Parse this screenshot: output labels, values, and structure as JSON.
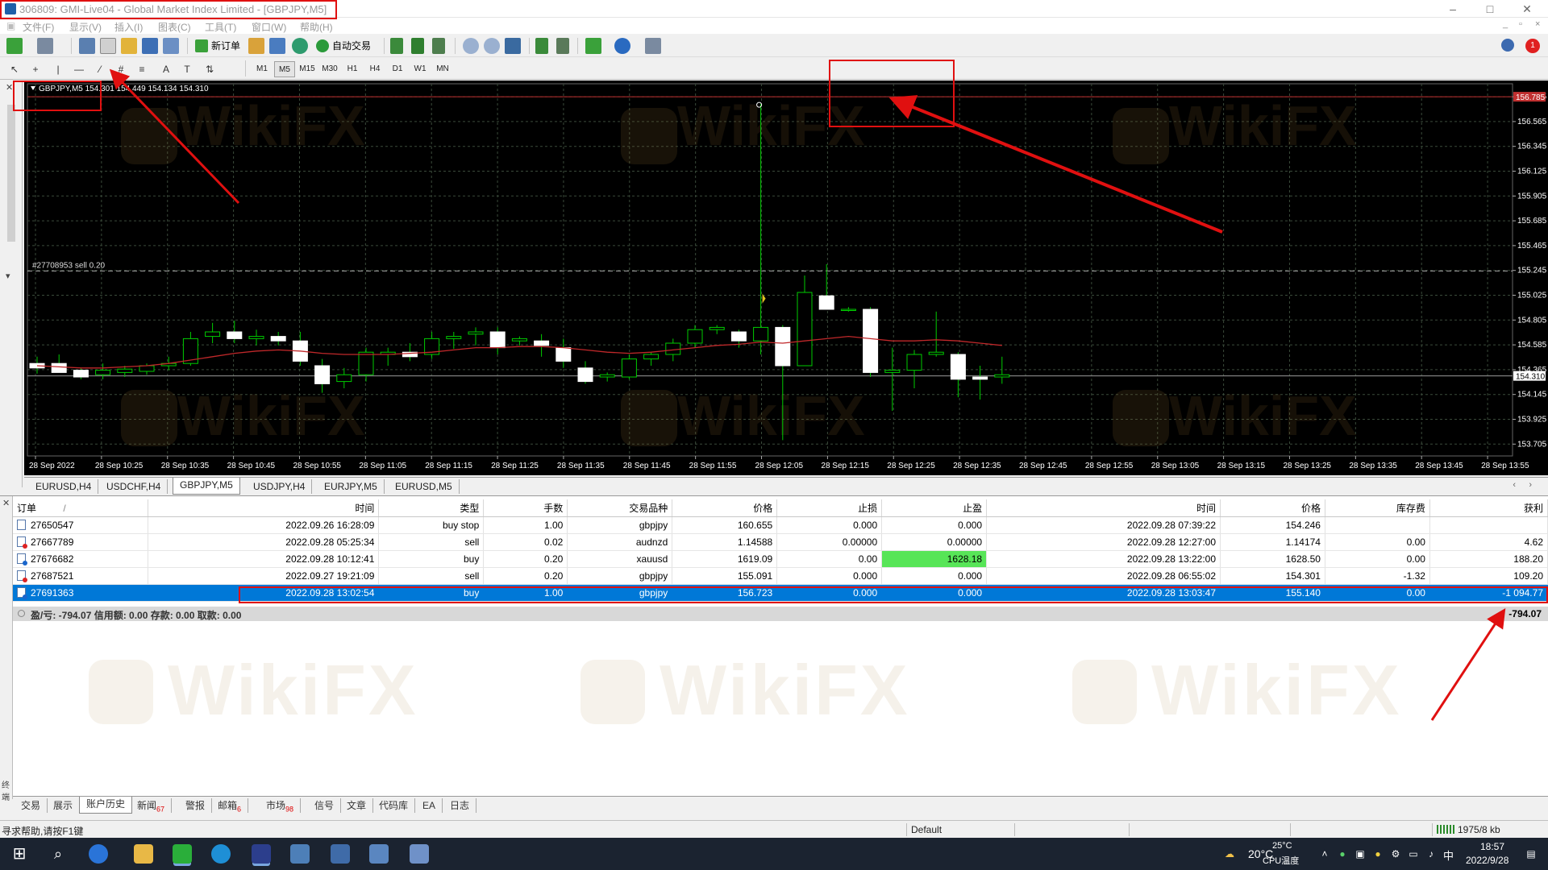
{
  "window": {
    "title": "306809: GMI-Live04 - Global Market Index Limited - [GBPJPY,M5]",
    "controls": [
      "–",
      "□",
      "✕"
    ]
  },
  "menu": {
    "items": [
      "文件(F)",
      "显示(V)",
      "插入(I)",
      "图表(C)",
      "工具(T)",
      "窗口(W)",
      "帮助(H)"
    ],
    "mdi_controls": [
      "_",
      "▫",
      "×"
    ]
  },
  "toolbar": {
    "new_order_label": "新订单",
    "auto_trade_label": "自动交易",
    "timeframes": [
      "M1",
      "M5",
      "M15",
      "M30",
      "H1",
      "H4",
      "D1",
      "W1",
      "MN"
    ],
    "active_timeframe": "M5",
    "draw_tools": [
      "↖",
      "+",
      "|",
      "—",
      "⁄",
      "#",
      "≡",
      "A",
      "T",
      "⇅"
    ],
    "alert_count": "1"
  },
  "chart": {
    "header_text": "GBPJPY,M5  154.301 154.449 154.134 154.310",
    "order_line_label": "#27708953 sell 0.20",
    "bid_label": "154.310",
    "top_label": "156.785",
    "colors": {
      "background": "#000000",
      "grid": "#3a4a3a",
      "candle_up": "#00cc00",
      "candle_body": "#ffffff",
      "ma": "#c0282a",
      "order_line": "#c03030",
      "axis_text": "#ffffff"
    }
  },
  "chart_data": {
    "type": "candlestick",
    "symbol": "GBPJPY",
    "timeframe": "M5",
    "ylim": [
      153.6,
      156.9
    ],
    "y_ticks": [
      "156.785",
      "156.565",
      "156.345",
      "156.125",
      "155.905",
      "155.685",
      "155.465",
      "155.245",
      "155.025",
      "154.805",
      "154.585",
      "154.365",
      "154.145",
      "153.925",
      "153.705"
    ],
    "x_ticks": [
      "28 Sep 2022",
      "28 Sep 10:25",
      "28 Sep 10:35",
      "28 Sep 10:45",
      "28 Sep 10:55",
      "28 Sep 11:05",
      "28 Sep 11:15",
      "28 Sep 11:25",
      "28 Sep 11:35",
      "28 Sep 11:45",
      "28 Sep 11:55",
      "28 Sep 12:05",
      "28 Sep 12:15",
      "28 Sep 12:25",
      "28 Sep 12:35",
      "28 Sep 12:45",
      "28 Sep 12:55",
      "28 Sep 13:05",
      "28 Sep 13:15",
      "28 Sep 13:25",
      "28 Sep 13:35",
      "28 Sep 13:45",
      "28 Sep 13:55"
    ],
    "candles": [
      [
        154.42,
        154.48,
        154.33,
        154.38
      ],
      [
        154.42,
        154.5,
        154.36,
        154.34
      ],
      [
        154.36,
        154.38,
        154.28,
        154.3
      ],
      [
        154.32,
        154.42,
        154.28,
        154.36
      ],
      [
        154.34,
        154.4,
        154.3,
        154.37
      ],
      [
        154.35,
        154.42,
        154.32,
        154.4
      ],
      [
        154.4,
        154.48,
        154.36,
        154.42
      ],
      [
        154.42,
        154.7,
        154.4,
        154.64
      ],
      [
        154.66,
        154.78,
        154.6,
        154.7
      ],
      [
        154.7,
        154.8,
        154.6,
        154.64
      ],
      [
        154.64,
        154.72,
        154.58,
        154.66
      ],
      [
        154.66,
        154.7,
        154.58,
        154.62
      ],
      [
        154.62,
        154.7,
        154.4,
        154.44
      ],
      [
        154.4,
        154.46,
        154.16,
        154.24
      ],
      [
        154.26,
        154.38,
        154.2,
        154.32
      ],
      [
        154.32,
        154.56,
        154.26,
        154.52
      ],
      [
        154.5,
        154.56,
        154.4,
        154.52
      ],
      [
        154.52,
        154.6,
        154.44,
        154.48
      ],
      [
        154.5,
        154.7,
        154.46,
        154.64
      ],
      [
        154.64,
        154.7,
        154.55,
        154.66
      ],
      [
        154.68,
        154.74,
        154.58,
        154.7
      ],
      [
        154.7,
        154.74,
        154.5,
        154.56
      ],
      [
        154.62,
        154.66,
        154.58,
        154.64
      ],
      [
        154.62,
        154.68,
        154.48,
        154.58
      ],
      [
        154.56,
        154.64,
        154.38,
        154.44
      ],
      [
        154.38,
        154.44,
        154.24,
        154.26
      ],
      [
        154.3,
        154.34,
        154.26,
        154.32
      ],
      [
        154.3,
        154.5,
        154.28,
        154.46
      ],
      [
        154.46,
        154.52,
        154.4,
        154.5
      ],
      [
        154.5,
        154.64,
        154.44,
        154.6
      ],
      [
        154.6,
        154.76,
        154.56,
        154.72
      ],
      [
        154.72,
        154.76,
        154.68,
        154.74
      ],
      [
        154.7,
        154.72,
        154.56,
        154.62
      ],
      [
        154.62,
        156.72,
        154.5,
        154.74
      ],
      [
        154.74,
        154.76,
        153.74,
        154.4
      ],
      [
        154.4,
        155.2,
        154.4,
        155.05
      ],
      [
        155.02,
        155.3,
        154.92,
        154.9
      ],
      [
        154.9,
        154.92,
        154.88,
        154.9
      ],
      [
        154.9,
        154.92,
        154.3,
        154.34
      ],
      [
        154.34,
        154.56,
        154.0,
        154.36
      ],
      [
        154.36,
        154.54,
        154.2,
        154.5
      ],
      [
        154.5,
        154.88,
        154.48,
        154.52
      ],
      [
        154.5,
        154.52,
        154.12,
        154.28
      ],
      [
        154.3,
        154.4,
        154.1,
        154.28
      ],
      [
        154.3,
        154.48,
        154.24,
        154.32
      ]
    ],
    "ma_values": [
      154.4,
      154.39,
      154.38,
      154.38,
      154.39,
      154.4,
      154.42,
      154.45,
      154.48,
      154.51,
      154.53,
      154.54,
      154.53,
      154.51,
      154.5,
      154.5,
      154.5,
      154.51,
      154.52,
      154.54,
      154.56,
      154.56,
      154.57,
      154.57,
      154.56,
      154.54,
      154.52,
      154.51,
      154.52,
      154.54,
      154.56,
      154.58,
      154.59,
      154.61,
      154.6,
      154.62,
      154.64,
      154.66,
      154.64,
      154.62,
      154.62,
      154.63,
      154.62,
      154.6,
      154.58
    ],
    "order_line_price": 155.24,
    "top_line_price": 156.785,
    "bid_price": 154.31,
    "marker_price": 155.01
  },
  "chart_tabs": {
    "items": [
      "EURUSD,H4",
      "USDCHF,H4",
      "GBPJPY,M5",
      "USDJPY,H4",
      "EURJPY,M5",
      "EURUSD,M5"
    ],
    "active": "GBPJPY,M5"
  },
  "orders": {
    "headers": [
      "订单",
      "时间",
      "类型",
      "手数",
      "交易品种",
      "价格",
      "止损",
      "止盈",
      "时间",
      "价格",
      "库存费",
      "获利"
    ],
    "sort_indicator": "/",
    "rows": [
      {
        "order": "27650547",
        "open_time": "2022.09.26 16:28:09",
        "type": "buy stop",
        "lots": "1.00",
        "symbol": "gbpjpy",
        "open_price": "160.655",
        "sl": "0.000",
        "tp": "0.000",
        "close_time": "2022.09.28 07:39:22",
        "close_price": "154.246",
        "swap": "",
        "profit": "",
        "kind": "pending"
      },
      {
        "order": "27667789",
        "open_time": "2022.09.28 05:25:34",
        "type": "sell",
        "lots": "0.02",
        "symbol": "audnzd",
        "open_price": "1.14588",
        "sl": "0.00000",
        "tp": "0.00000",
        "close_time": "2022.09.28 12:27:00",
        "close_price": "1.14174",
        "swap": "0.00",
        "profit": "4.62",
        "kind": "sell"
      },
      {
        "order": "27676682",
        "open_time": "2022.09.28 10:12:41",
        "type": "buy",
        "lots": "0.20",
        "symbol": "xauusd",
        "open_price": "1619.09",
        "sl": "0.00",
        "tp": "1628.18",
        "close_time": "2022.09.28 13:22:00",
        "close_price": "1628.50",
        "swap": "0.00",
        "profit": "188.20",
        "kind": "buy",
        "tp_highlight": true
      },
      {
        "order": "27687521",
        "open_time": "2022.09.27 19:21:09",
        "type": "sell",
        "lots": "0.20",
        "symbol": "gbpjpy",
        "open_price": "155.091",
        "sl": "0.000",
        "tp": "0.000",
        "close_time": "2022.09.28 06:55:02",
        "close_price": "154.301",
        "swap": "-1.32",
        "profit": "109.20",
        "kind": "sell"
      },
      {
        "order": "27691363",
        "open_time": "2022.09.28 13:02:54",
        "type": "buy",
        "lots": "1.00",
        "symbol": "gbpjpy",
        "open_price": "156.723",
        "sl": "0.000",
        "tp": "0.000",
        "close_time": "2022.09.28 13:03:47",
        "close_price": "155.140",
        "swap": "0.00",
        "profit": "-1 094.77",
        "kind": "buy",
        "selected": true
      }
    ],
    "summary": "盈/亏: -794.07  信用额: 0.00  存款: 0.00  取款: 0.00",
    "summary_total": "-794.07"
  },
  "watermark_text": "WikiFX",
  "terminal_tabs": {
    "items": [
      {
        "label": "交易",
        "badge": ""
      },
      {
        "label": "展示",
        "badge": ""
      },
      {
        "label": "账户历史",
        "badge": ""
      },
      {
        "label": "新闻",
        "badge": "67"
      },
      {
        "label": "警报",
        "badge": ""
      },
      {
        "label": "邮箱",
        "badge": "6"
      },
      {
        "label": "市场",
        "badge": "98"
      },
      {
        "label": "信号",
        "badge": ""
      },
      {
        "label": "文章",
        "badge": ""
      },
      {
        "label": "代码库",
        "badge": ""
      },
      {
        "label": "EA",
        "badge": ""
      },
      {
        "label": "日志",
        "badge": ""
      }
    ],
    "active": "账户历史",
    "side_label": "终端"
  },
  "statusbar": {
    "help": "寻求帮助,请按F1键",
    "profile": "Default",
    "traffic": "1975/8 kb"
  },
  "taskbar": {
    "weather_temp": "20°C",
    "cpu_temp": "25°C",
    "cpu_label": "CPU温度",
    "ime": "中",
    "time": "18:57",
    "date": "2022/9/28"
  }
}
